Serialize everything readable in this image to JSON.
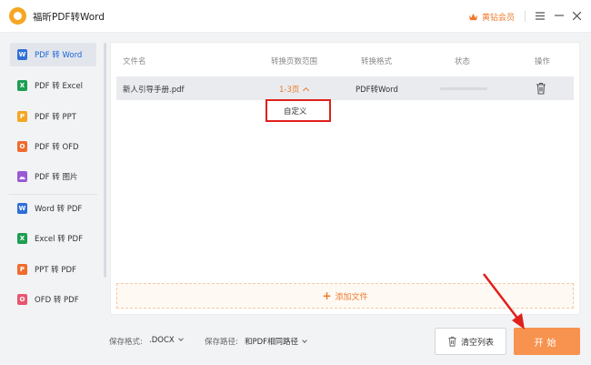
{
  "app": {
    "title": "福昕PDF转Word",
    "vip_label": "黄钻会员"
  },
  "sidebar": {
    "items": [
      {
        "label": "PDF 转 Word",
        "icon": "word-icon",
        "icon_letter": "W",
        "color": "#2f6fd6"
      },
      {
        "label": "PDF 转 Excel",
        "icon": "excel-icon",
        "icon_letter": "X",
        "color": "#1e9e52"
      },
      {
        "label": "PDF 转 PPT",
        "icon": "ppt-icon",
        "icon_letter": "P",
        "color": "#f5a623"
      },
      {
        "label": "PDF 转 OFD",
        "icon": "ofd-icon",
        "icon_letter": "O",
        "color": "#ef6c2f"
      },
      {
        "label": "PDF 转 图片",
        "icon": "image-icon",
        "icon_letter": "",
        "color": "#9b59d6"
      },
      {
        "label": "Word 转 PDF",
        "icon": "word-icon",
        "icon_letter": "W",
        "color": "#2f6fd6"
      },
      {
        "label": "Excel 转 PDF",
        "icon": "excel-icon",
        "icon_letter": "X",
        "color": "#1e9e52"
      },
      {
        "label": "PPT 转 PDF",
        "icon": "ppt-icon",
        "icon_letter": "P",
        "color": "#ef6c2f"
      },
      {
        "label": "OFD 转 PDF",
        "icon": "ofd-icon",
        "icon_letter": "O",
        "color": "#e8556f"
      }
    ]
  },
  "table": {
    "headers": {
      "filename": "文件名",
      "range": "转换页数范围",
      "format": "转换格式",
      "status": "状态",
      "action": "操作"
    },
    "rows": [
      {
        "filename": "新人引导手册.pdf",
        "range": "1-3页",
        "format": "PDF转Word",
        "progress": 0
      }
    ],
    "range_dropdown": {
      "option": "自定义"
    },
    "add_file_label": "添加文件"
  },
  "footer": {
    "format_label": "保存格式:",
    "format_value": ".DOCX",
    "path_label": "保存路径:",
    "path_value": "和PDF相同路径",
    "clear_label": "清空列表",
    "start_label": "开始"
  },
  "colors": {
    "accent": "#f07a2c",
    "start_button": "#f7934f",
    "highlight": "#e0201c",
    "active_nav": "#1a63d6"
  }
}
